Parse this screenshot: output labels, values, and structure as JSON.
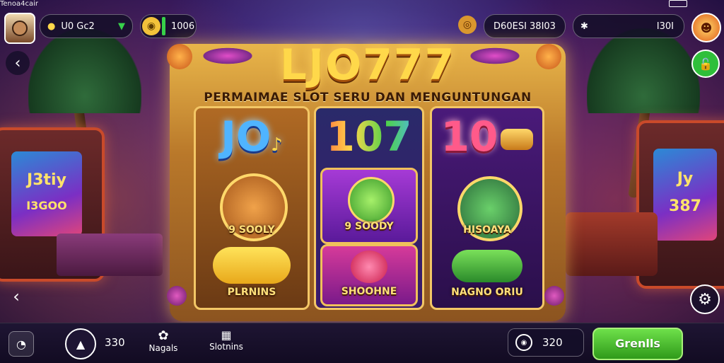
{
  "top_bar": {
    "site_label": "Tenoa4cair",
    "account_label": "U0 Gc2",
    "coin_balance": "1006",
    "jackpot_value": "D60ESI 38I03",
    "gems_value": "I30I"
  },
  "machine": {
    "title": "LJO777",
    "subtitle": "PERMAIMAE SLOT SERU DAN MENGUNTUNGAN"
  },
  "reels": [
    {
      "header": "JO",
      "header_mark": "♪",
      "top_caption": "9 SOOLY",
      "bottom_caption": "PLRNINS"
    },
    {
      "header": "107",
      "top_caption": "9 SOODY",
      "bottom_caption": "SHOOHNE"
    },
    {
      "header": "10",
      "top_caption": "HISOAYA",
      "bottom_caption": "NAGNO ORIU"
    }
  ],
  "left_cabinet": {
    "screen_top": "J3tiy",
    "screen_bottom": "I3GOO"
  },
  "right_cabinet": {
    "screen_top": "Jy",
    "screen_bottom": "387"
  },
  "bottom_bar": {
    "level_value": "330",
    "nav_items": [
      {
        "label": "Nagals",
        "icon": "gift-icon"
      },
      {
        "label": "Slotnins",
        "icon": "slot-icon"
      }
    ],
    "bet_value": "320",
    "spin_label": "Grenlls"
  },
  "colors": {
    "spin_button": "#3fbf2a",
    "title_gold": "#ffd84a",
    "frame_gold": "#e9b64a",
    "status_green": "#2fbf3a"
  }
}
